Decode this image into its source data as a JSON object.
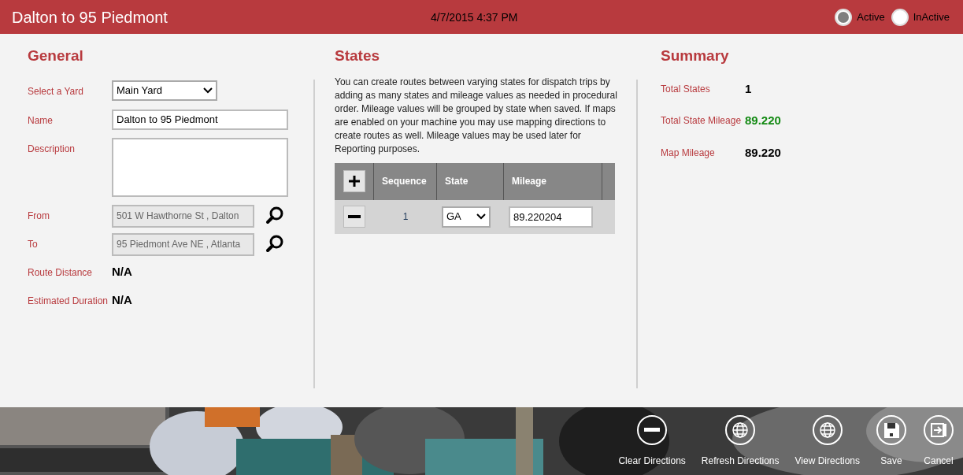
{
  "header": {
    "title": "Dalton to 95 Piedmont",
    "datetime": "4/7/2015 4:37 PM",
    "status_options": [
      {
        "label": "Active",
        "selected": true
      },
      {
        "label": "InActive",
        "selected": false
      }
    ]
  },
  "general": {
    "heading": "General",
    "fields": [
      {
        "kind": "select",
        "label": "Select a Yard",
        "value": "Main Yard"
      },
      {
        "kind": "text",
        "label": "Name",
        "value": "Dalton to 95 Piedmont"
      },
      {
        "kind": "textarea",
        "label": "Description"
      },
      {
        "kind": "lookup",
        "label": "From",
        "value": "501 W Hawthorne St , Dalton",
        "disabled": true
      },
      {
        "kind": "lookup",
        "label": "To",
        "value": "95 Piedmont Ave NE , Atlanta",
        "disabled": true
      },
      {
        "kind": "readout",
        "label": "Route Distance",
        "value": "N/A"
      },
      {
        "kind": "readout",
        "label": "Estimated Duration",
        "value": "N/A"
      }
    ]
  },
  "states": {
    "heading": "States",
    "description": "You can create routes between varying states for dispatch trips by adding as many states and mileage values as needed in procedural order. Mileage values will be grouped by state when saved. If maps are enabled on your machine you may use mapping directions to create routes as well. Mileage values may be used later for Reporting purposes.",
    "table": {
      "columns": [
        "Sequence",
        "State",
        "Mileage"
      ],
      "rows": [
        {
          "sequence": "1",
          "state": "GA",
          "mileage": "89.220204"
        }
      ]
    }
  },
  "summary": {
    "heading": "Summary",
    "items": [
      {
        "label": "Total States",
        "value": "1",
        "color": "#000000"
      },
      {
        "label": "Total State Mileage",
        "value": "89.220",
        "color": "#138a13"
      },
      {
        "label": "Map Mileage",
        "value": "89.220",
        "color": "#000000"
      }
    ]
  },
  "toolbar": {
    "buttons": [
      {
        "kind": "minus",
        "label": "Clear Directions"
      },
      {
        "kind": "globe",
        "label": "Refresh Directions"
      },
      {
        "kind": "globe",
        "label": "View Directions"
      },
      {
        "kind": "save",
        "label": "Save"
      },
      {
        "kind": "exit",
        "label": "Cancel"
      }
    ]
  }
}
